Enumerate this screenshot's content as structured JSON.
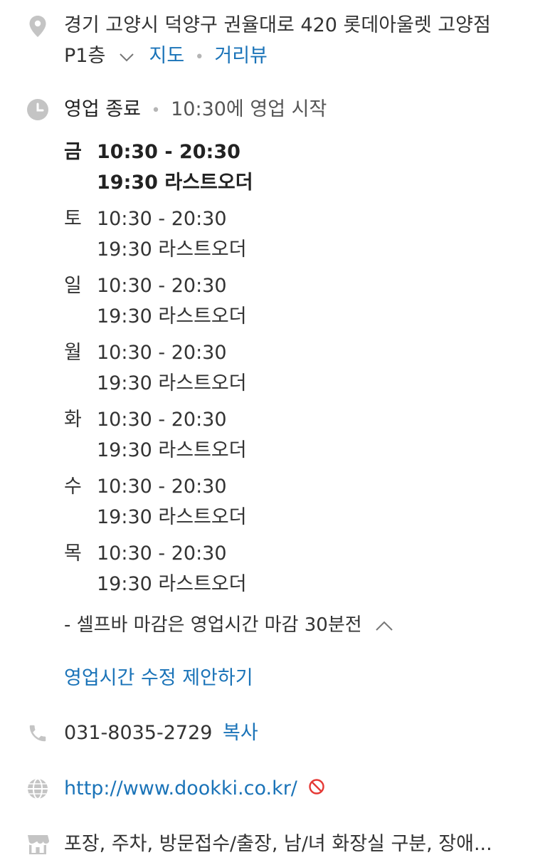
{
  "address": {
    "icon": "location-pin-icon",
    "line1": "경기 고양시 덕양구 권율대로 420 롯데아울렛 고양점",
    "line2": "P1층",
    "map_link": "지도",
    "separator": "•",
    "street_view_link": "거리뷰"
  },
  "hours": {
    "icon": "clock-icon",
    "status": "영업 종료",
    "separator": "•",
    "next_open": "10:30에 영업 시작",
    "days": [
      {
        "day": "금",
        "time": "10:30 - 20:30",
        "last_order": "19:30 라스트오더",
        "today": true
      },
      {
        "day": "토",
        "time": "10:30 - 20:30",
        "last_order": "19:30 라스트오더",
        "today": false
      },
      {
        "day": "일",
        "time": "10:30 - 20:30",
        "last_order": "19:30 라스트오더",
        "today": false
      },
      {
        "day": "월",
        "time": "10:30 - 20:30",
        "last_order": "19:30 라스트오더",
        "today": false
      },
      {
        "day": "화",
        "time": "10:30 - 20:30",
        "last_order": "19:30 라스트오더",
        "today": false
      },
      {
        "day": "수",
        "time": "10:30 - 20:30",
        "last_order": "19:30 라스트오더",
        "today": false
      },
      {
        "day": "목",
        "time": "10:30 - 20:30",
        "last_order": "19:30 라스트오더",
        "today": false
      }
    ],
    "note": "- 셀프바 마감은 영업시간 마감 30분전",
    "suggest_edit": "영업시간 수정 제안하기"
  },
  "phone": {
    "icon": "phone-icon",
    "number": "031-8035-2729",
    "copy_label": "복사"
  },
  "website": {
    "icon": "globe-icon",
    "url": "http://www.dookki.co.kr/",
    "badge_icon": "blocked-icon"
  },
  "amenities": {
    "icon": "store-icon",
    "text": "포장, 주차, 방문접수/출장, 남/녀 화장실 구분, 장애..."
  },
  "colors": {
    "link": "#1a73b8",
    "icon_gray": "#c4c4c4",
    "text": "#333333",
    "blocked_red": "#e53935"
  }
}
